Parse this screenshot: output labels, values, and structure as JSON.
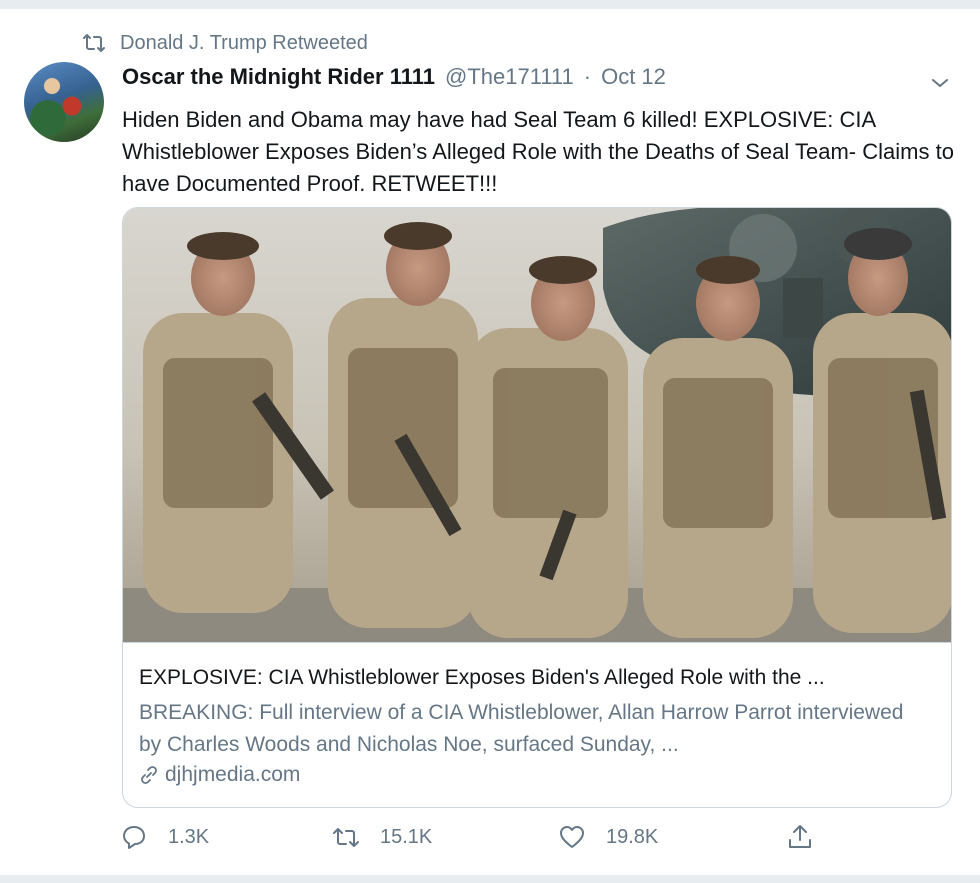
{
  "retweet_context": {
    "label": "Donald J. Trump Retweeted",
    "icon": "retweet-icon"
  },
  "tweet": {
    "display_name": "Oscar the Midnight Rider 1111",
    "handle": "@The171111",
    "separator": "·",
    "date": "Oct 12",
    "text": "Hiden Biden and Obama may have had Seal Team 6 killed! EXPLOSIVE: CIA Whistleblower Exposes Biden’s Alleged Role with the Deaths of Seal Team- Claims to have Documented Proof. RETWEET!!!"
  },
  "card": {
    "title": "EXPLOSIVE: CIA Whistleblower Exposes Biden's Alleged Role with the ...",
    "description": "BREAKING: Full interview of a CIA Whistleblower, Allan Harrow Parrot interviewed by Charles Woods and Nicholas Noe, surfaced Sunday, ...",
    "domain": "djhjmedia.com",
    "link_icon": "link-icon"
  },
  "actions": {
    "reply": {
      "count": "1.3K",
      "icon": "reply-icon"
    },
    "retweet": {
      "count": "15.1K",
      "icon": "retweet-icon"
    },
    "like": {
      "count": "19.8K",
      "icon": "heart-icon"
    },
    "share": {
      "icon": "share-icon"
    }
  },
  "colors": {
    "text": "#14171a",
    "secondary": "#657786",
    "border": "#ccd6dd",
    "background": "#e6ecf0"
  }
}
